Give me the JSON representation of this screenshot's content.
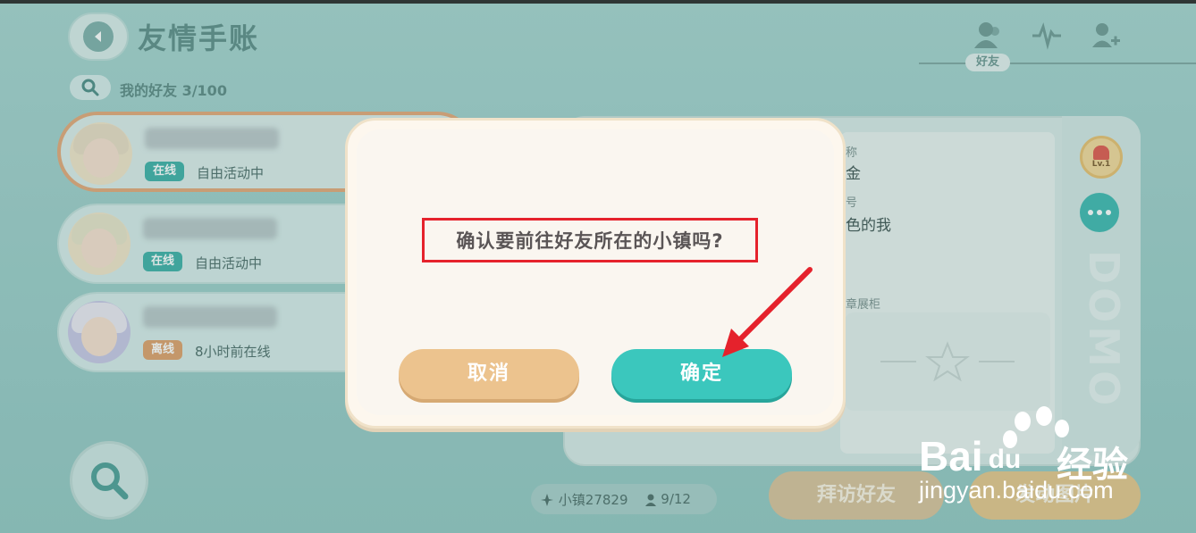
{
  "header": {
    "title": "友情手账",
    "friend_count": "我的好友 3/100",
    "friends_tab_label": "好友"
  },
  "friends": [
    {
      "status": "在线",
      "status_color": "#3fb0a8",
      "activity": "自由活动中"
    },
    {
      "status": "在线",
      "status_color": "#3fb0a8",
      "activity": "自由活动中"
    },
    {
      "status": "离线",
      "status_color": "#e0a06b",
      "activity": "8小时前在线"
    }
  ],
  "profile": {
    "name_label_fragment": "称",
    "name_value_fragment": "金",
    "sign_label_fragment": "号",
    "sign_value_fragment": "色的我",
    "showcase_label_fragment": "章展柜",
    "level": "Lv.1",
    "brand_vertical": "DOMO"
  },
  "bottom": {
    "town": "小镇27829",
    "people": "9/12",
    "visit_button": "拜访好友",
    "gift_button": "发动图片"
  },
  "dialog": {
    "message": "确认要前往好友所在的小镇吗?",
    "cancel": "取消",
    "confirm": "确定"
  },
  "watermark": {
    "brand": "Bai",
    "brand_mid": "du",
    "suffix": "经验",
    "url": "jingyan.baidu.com"
  },
  "colors": {
    "accent_teal": "#3bc7bd",
    "cancel_orange": "#ecc38e",
    "highlight_red": "#e5222c"
  }
}
